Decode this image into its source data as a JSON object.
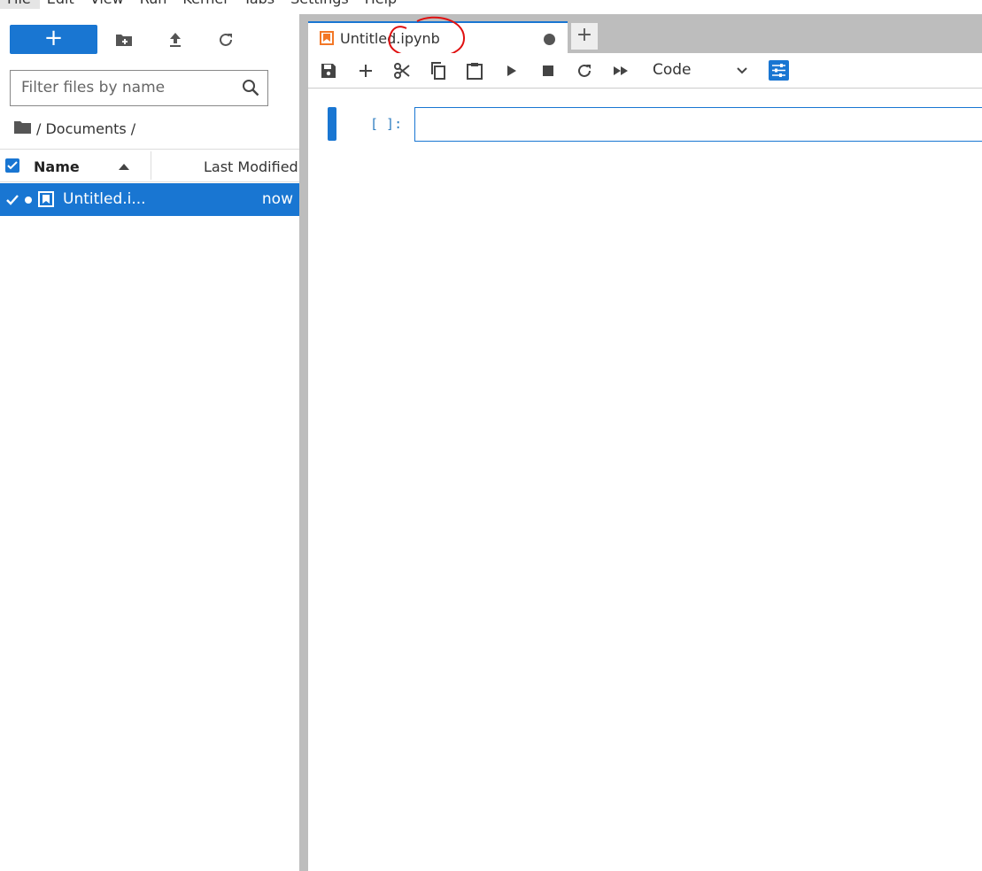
{
  "menubar": {
    "items": [
      {
        "label": "File"
      },
      {
        "label": "Edit"
      },
      {
        "label": "View"
      },
      {
        "label": "Run"
      },
      {
        "label": "Kernel"
      },
      {
        "label": "Tabs"
      },
      {
        "label": "Settings"
      },
      {
        "label": "Help"
      }
    ]
  },
  "filebrowser": {
    "new_button_label": "+",
    "filter_placeholder": "Filter files by name",
    "breadcrumb": "/ Documents /",
    "columns": {
      "name": "Name",
      "modified": "Last Modified"
    },
    "files": [
      {
        "name": "Untitled.i...",
        "modified": "now",
        "selected": true,
        "running": true
      }
    ]
  },
  "tabs": [
    {
      "label": "Untitled.ipynb",
      "active": true,
      "dirty": true
    }
  ],
  "add_tab_label": "+",
  "notebook": {
    "cell_type": "Code",
    "cells": [
      {
        "prompt": "[ ]:",
        "source": ""
      }
    ]
  },
  "colors": {
    "accent": "#1976d2",
    "annotation": "#e01010",
    "notebook_icon": "#f37726"
  }
}
